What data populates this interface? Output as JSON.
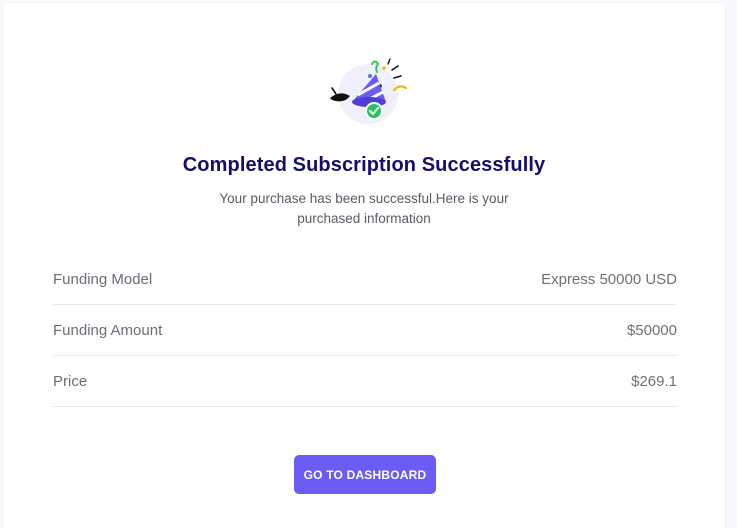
{
  "title": "Completed Subscription Successfully",
  "subtitle": "Your purchase has been successful.Here is your purchased information",
  "details": [
    {
      "label": "Funding Model",
      "value": "Express 50000 USD"
    },
    {
      "label": "Funding Amount",
      "value": "$50000"
    },
    {
      "label": "Price",
      "value": "$269.1"
    }
  ],
  "button_label": "GO TO DASHBOARD",
  "colors": {
    "title": "#120e6b",
    "accent": "#6b5cf6",
    "success": "#22c55e"
  },
  "icons": [
    "party-popper-icon",
    "check-circle-icon"
  ]
}
